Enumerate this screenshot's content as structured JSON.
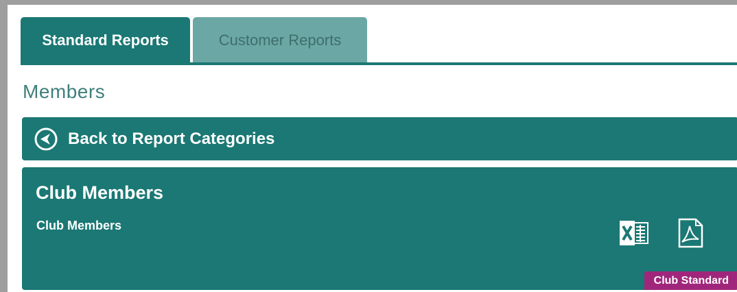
{
  "tabs": [
    {
      "label": "Standard Reports",
      "active": true
    },
    {
      "label": "Customer Reports",
      "active": false
    }
  ],
  "section": {
    "title": "Members"
  },
  "back": {
    "label": "Back to Report Categories",
    "icon": "circle-arrow-left-icon"
  },
  "report": {
    "title": "Club Members",
    "description": "Club Members",
    "badge": "Club Standard",
    "export_icons": [
      "excel-icon",
      "pdf-icon"
    ]
  },
  "colors": {
    "primary": "#1b7874",
    "tab_inactive": "#6ba7a5",
    "section_title": "#3f7f7b",
    "badge": "#a0267b",
    "frame": "#9e9e9e"
  }
}
